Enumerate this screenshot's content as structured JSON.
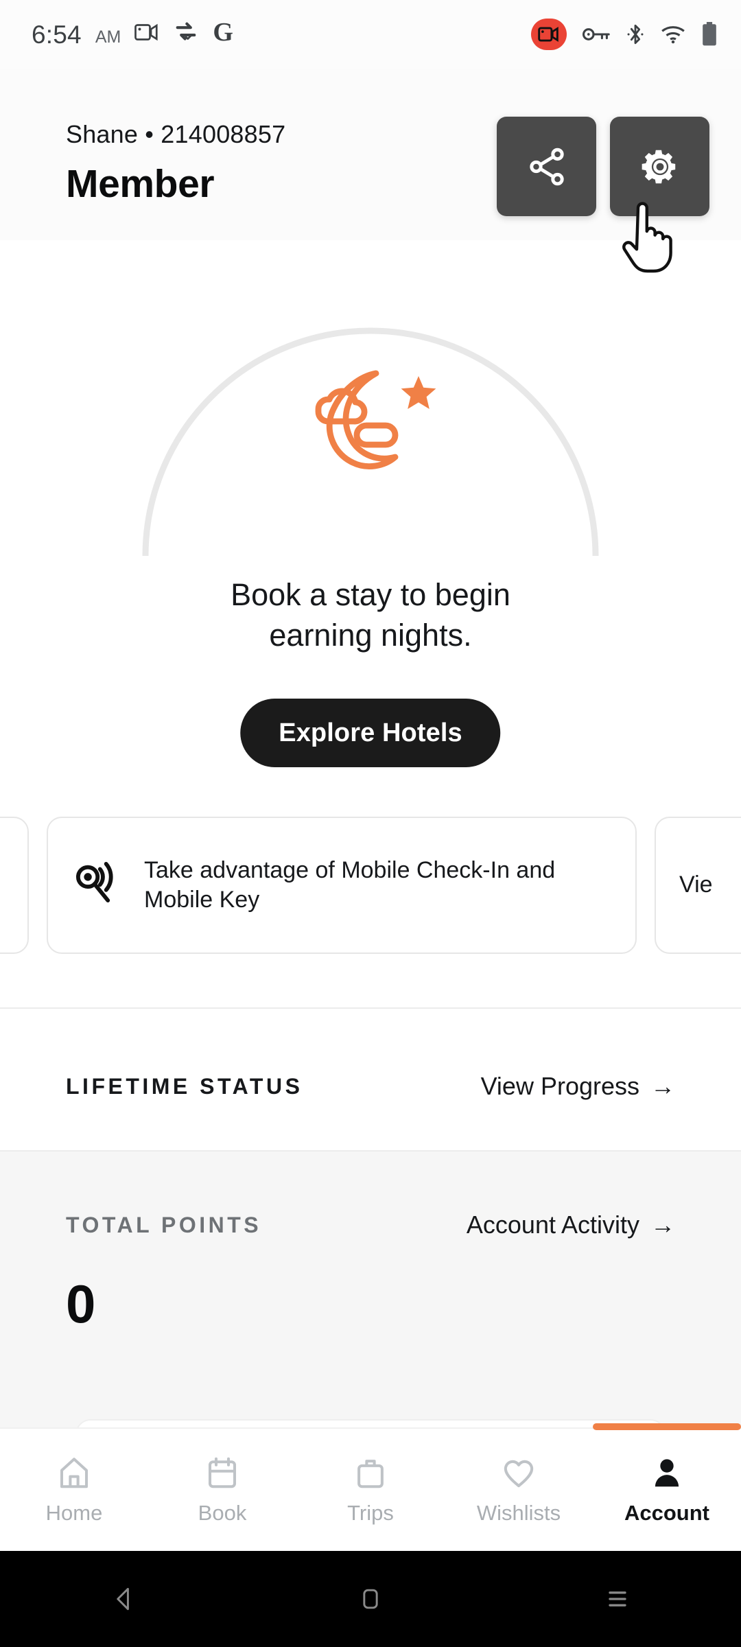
{
  "status_bar": {
    "time": "6:54",
    "ampm": "AM",
    "left_icons": [
      "screen-record-video-icon",
      "vpn-swap-icon",
      "google-g-icon"
    ],
    "right_icons": [
      "screen-recording-active-icon",
      "vpn-key-icon",
      "bluetooth-icon",
      "wifi-icon",
      "battery-icon"
    ],
    "recording_badge_color": "#ea4335"
  },
  "header": {
    "member_line": "Shane • 214008857",
    "tier": "Member",
    "share_button_label": "share-icon",
    "settings_button_label": "gear-icon",
    "button_bg": "#4a4a4a"
  },
  "hero": {
    "icon_name": "moon-cloud-star-icon",
    "icon_color": "#f08046",
    "ring_color": "#e8e8e8",
    "headline_line1": "Book a stay to begin",
    "headline_line2": "earning nights.",
    "cta_label": "Explore Hotels",
    "cta_bg": "#1b1b1b"
  },
  "carousel": {
    "cards": [
      {
        "icon": "",
        "text": ""
      },
      {
        "icon": "mobile-key-wireless-icon",
        "text": "Take advantage of Mobile Check-In and Mobile Key"
      },
      {
        "icon": "",
        "text": "Vie"
      }
    ]
  },
  "lifetime_status": {
    "label": "LIFETIME STATUS",
    "link_label": "View Progress",
    "link_arrow": "→"
  },
  "total_points": {
    "label": "TOTAL POINTS",
    "link_label": "Account Activity",
    "link_arrow": "→",
    "value": "0",
    "panel_bg": "#f6f6f6"
  },
  "bottom_nav": {
    "accent_color": "#f08046",
    "items": [
      {
        "label": "Home",
        "icon": "home-icon",
        "active": false
      },
      {
        "label": "Book",
        "icon": "calendar-icon",
        "active": false
      },
      {
        "label": "Trips",
        "icon": "briefcase-icon",
        "active": false
      },
      {
        "label": "Wishlists",
        "icon": "heart-icon",
        "active": false
      },
      {
        "label": "Account",
        "icon": "person-icon",
        "active": true
      }
    ]
  },
  "android_nav": {
    "back": "back-triangle-icon",
    "home": "home-square-icon",
    "recents": "recents-lines-icon"
  },
  "cursor": {
    "type": "pointing-hand-cursor"
  }
}
